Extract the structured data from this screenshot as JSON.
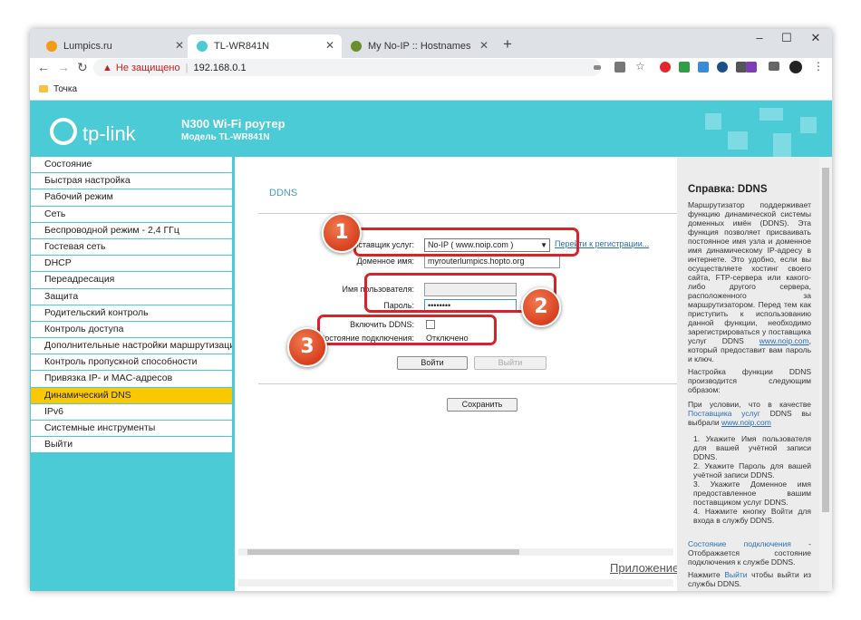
{
  "browser": {
    "tabs": [
      {
        "title": "Lumpics.ru",
        "active": false
      },
      {
        "title": "TL-WR841N",
        "active": true
      },
      {
        "title": "My No-IP :: Hostnames",
        "active": false
      }
    ],
    "security_label": "Не защищено",
    "url": "192.168.0.1",
    "bookmark": "Точка",
    "window_controls": {
      "minimize": "–",
      "maximize": "☐",
      "close": "✕"
    },
    "new_tab": "+"
  },
  "router": {
    "logo_text": "tp-link",
    "product_name": "N300 Wi-Fi роутер",
    "model": "Модель TL-WR841N"
  },
  "menu": {
    "items": [
      "Состояние",
      "Быстрая настройка",
      "Рабочий режим",
      "Сеть",
      "Беспроводной режим - 2,4 ГГц",
      "Гостевая сеть",
      "DHCP",
      "Переадресация",
      "Защита",
      "Родительский контроль",
      "Контроль доступа",
      "Дополнительные настройки маршрутизации",
      "Контроль пропускной способности",
      "Привязка IP- и MAC-адресов",
      "Динамический DNS",
      "IPv6",
      "Системные инструменты",
      "Выйти"
    ],
    "selected_index": 14
  },
  "ddns": {
    "title": "DDNS",
    "provider_label": "Поставщик услуг:",
    "provider_value": "No-IP ( www.noip.com )",
    "register_link": "Перейти к регистрации...",
    "domain_label": "Доменное имя:",
    "domain_value": "myrouterlumpics.hopto.org",
    "username_label": "Имя пользователя:",
    "password_label": "Пароль:",
    "password_value": "••••••••",
    "enable_label": "Включить DDNS:",
    "status_label": "Состояние подключения:",
    "status_value": "Отключено",
    "login_button": "Войти",
    "logout_button": "Выйти",
    "save_button": "Сохранить",
    "app_link": "Приложение"
  },
  "help": {
    "title": "Справка: DDNS",
    "para1": "Маршрутизатор поддерживает функцию динамической системы доменных имён (DDNS). Эта функция позволяет присваивать постоянное имя узла и доменное имя динамическому IP-адресу в интернете. Это удобно, если вы осуществляете хостинг своего сайта, FTP-сервера или какого-либо другого сервера, расположенного за маршрутизатором. Перед тем как приступить к использованию данной функции, необходимо зарегистрироваться у поставщика услуг DDNS",
    "para1_link": "www.noip.com",
    "para1_end": ", который предоставит вам пароль и ключ.",
    "para2": "Настройка функции DDNS производится следующим образом:",
    "para3_start": "При условии, что в качестве",
    "para3_bold": "Поставщика услуг",
    "para3_mid": "DDNS вы выбрали",
    "para3_link": "www.noip.com",
    "steps": [
      "Укажите Имя пользователя для вашей учётной записи DDNS.",
      "Укажите Пароль для вашей учётной записи DDNS.",
      "Укажите Доменное имя предоставленное вашим поставщиком услуг DDNS.",
      "Нажмите кнопку Войти для входа в службу DDNS."
    ],
    "status_term": "Состояние подключения",
    "status_desc": "- Отображается состояние подключения к службе DDNS.",
    "logout_start": "Нажмите",
    "logout_term": "Выйти",
    "logout_end": "чтобы выйти из службы DDNS."
  },
  "annotations": {
    "markers": [
      "1",
      "2",
      "3"
    ],
    "color": "#d8232a"
  }
}
